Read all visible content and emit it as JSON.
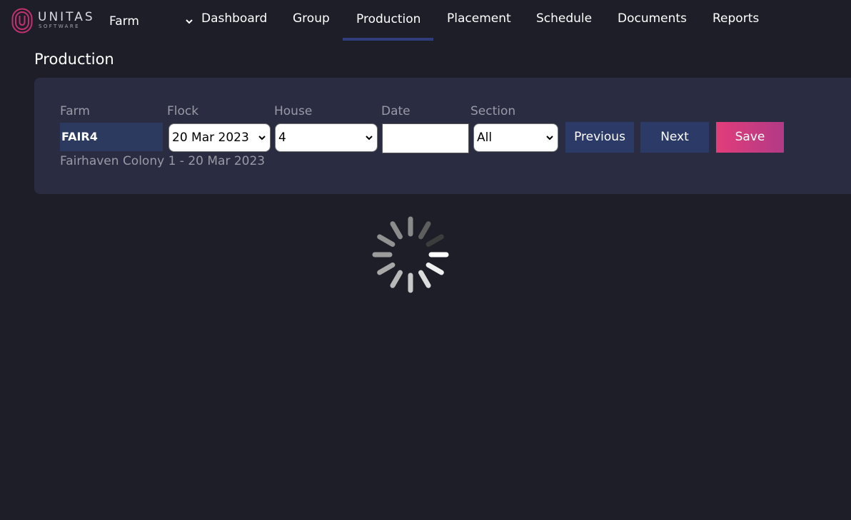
{
  "brand": {
    "name": "UNITAS",
    "sub": "SOFTWARE"
  },
  "header": {
    "context_label": "Farm",
    "nav": [
      "Dashboard",
      "Group",
      "Production",
      "Placement",
      "Schedule",
      "Documents",
      "Reports"
    ],
    "active_tab": "Production"
  },
  "page": {
    "title": "Production"
  },
  "form": {
    "labels": {
      "farm": "Farm",
      "flock": "Flock",
      "house": "House",
      "date": "Date",
      "section": "Section"
    },
    "farm_value": "FAIR4",
    "flock_value": "20 Mar 2023",
    "house_value": "4",
    "date_value": "",
    "section_value": "All",
    "buttons": {
      "previous": "Previous",
      "next": "Next",
      "save": "Save"
    },
    "flock_description": "Fairhaven Colony 1 - 20 Mar 2023"
  },
  "colors": {
    "background": "#1e1e28",
    "panel": "#2a2c42",
    "nav_button": "#2c3a68",
    "save_gradient_start": "#e23d7a",
    "save_gradient_end": "#b23a86",
    "active_underline": "#2f3d7c"
  },
  "icons": {
    "logo": "unitas-logo-icon",
    "context_dropdown": "chevron-down-icon",
    "loading": "loading-spinner-icon"
  }
}
